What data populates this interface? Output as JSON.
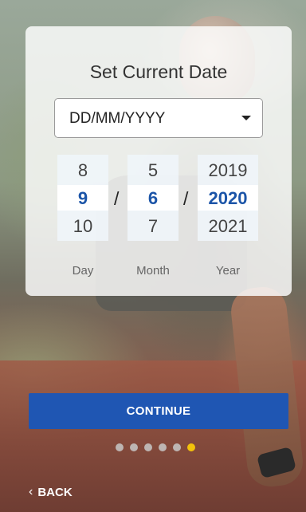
{
  "title": "Set Current Date",
  "format_select": {
    "value": "DD/MM/YYYY"
  },
  "picker": {
    "day": {
      "prev": "8",
      "selected": "9",
      "next": "10",
      "label": "Day"
    },
    "month": {
      "prev": "5",
      "selected": "6",
      "next": "7",
      "label": "Month"
    },
    "year": {
      "prev": "2019",
      "selected": "2020",
      "next": "2021",
      "label": "Year"
    },
    "separator": "/"
  },
  "continue_label": "CONTINUE",
  "pagination": {
    "total": 6,
    "active_index": 5
  },
  "back": {
    "icon": "chevron-left-icon",
    "label": "BACK"
  },
  "colors": {
    "accent": "#1f56b3",
    "selected_text": "#1c55a8",
    "dot_active": "#f3c20b"
  }
}
